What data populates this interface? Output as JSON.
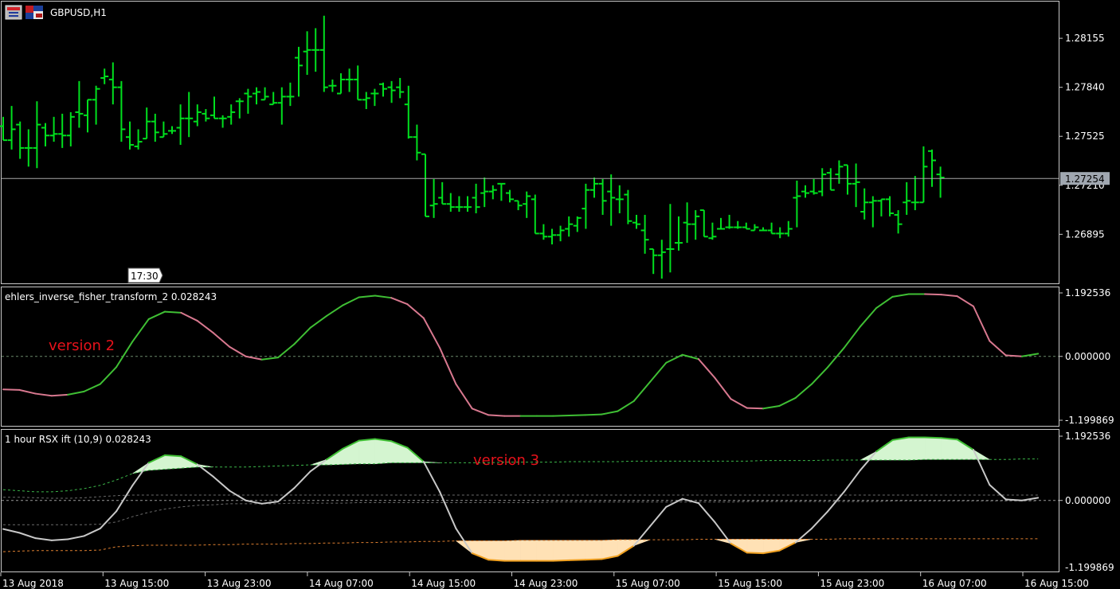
{
  "window": {
    "title": "GBPUSD,H1",
    "icons": [
      "chart-window-icon",
      "symbol-flag-icon"
    ]
  },
  "colors": {
    "background": "#000000",
    "bar": "#00e01e",
    "price_line": "#a8a8a8",
    "axis": "#c8c8c8",
    "up": "#3fbf34",
    "down": "#d8788f",
    "neutral": "#c8c8c8",
    "fill_up": "#d4f5d0",
    "fill_down": "#ffe1b5",
    "edge_down": "#f0a020",
    "level_up": "#3cb84a",
    "level_down": "#e08030",
    "annotation": "#e8121b"
  },
  "time_marker": "17:30",
  "time_axis": [
    "13 Aug 2018",
    "13 Aug 15:00",
    "13 Aug 23:00",
    "14 Aug 07:00",
    "14 Aug 15:00",
    "14 Aug 23:00",
    "15 Aug 07:00",
    "15 Aug 15:00",
    "15 Aug 23:00",
    "16 Aug 07:00",
    "16 Aug 15:00"
  ],
  "chart_data": [
    {
      "type": "ohlc",
      "symbol": "GBPUSD",
      "timeframe": "H1",
      "title": "GBPUSD,H1",
      "ylim": [
        1.266,
        1.2835
      ],
      "y_ticks": [
        "1.28155",
        "1.27840",
        "1.27525",
        "1.27210",
        "1.26895"
      ],
      "current_price": "1.27254",
      "bars": [
        [
          1.2759,
          1.2765,
          1.2756,
          1.275
        ],
        [
          1.275,
          1.2772,
          1.2744,
          1.2757
        ],
        [
          1.276,
          1.2762,
          1.2738,
          1.2745
        ],
        [
          1.2745,
          1.2757,
          1.2733,
          1.2745
        ],
        [
          1.2745,
          1.2775,
          1.2732,
          1.276
        ],
        [
          1.2758,
          1.2761,
          1.2746,
          1.2753
        ],
        [
          1.2753,
          1.2765,
          1.2749,
          1.2754
        ],
        [
          1.2754,
          1.2767,
          1.2745,
          1.2753
        ],
        [
          1.2753,
          1.2768,
          1.2746,
          1.2765
        ],
        [
          1.2768,
          1.2788,
          1.2758,
          1.2767
        ],
        [
          1.2766,
          1.2776,
          1.2755,
          1.2776
        ],
        [
          1.2776,
          1.2785,
          1.276,
          1.2783
        ],
        [
          1.279,
          1.2796,
          1.2786,
          1.2791
        ],
        [
          1.2789,
          1.28,
          1.2773,
          1.2784
        ],
        [
          1.2784,
          1.2788,
          1.2749,
          1.2757
        ],
        [
          1.2752,
          1.2762,
          1.2744,
          1.2747
        ],
        [
          1.2746,
          1.2757,
          1.2744,
          1.2749
        ],
        [
          1.2751,
          1.2771,
          1.2753,
          1.2762
        ],
        [
          1.2762,
          1.2767,
          1.2749,
          1.2755
        ],
        [
          1.2752,
          1.2762,
          1.2753,
          1.2754
        ],
        [
          1.2756,
          1.2759,
          1.2754,
          1.2756
        ],
        [
          1.2758,
          1.2773,
          1.2747,
          1.2764
        ],
        [
          1.2764,
          1.2781,
          1.2752,
          1.2764
        ],
        [
          1.2762,
          1.2773,
          1.2759,
          1.2768
        ],
        [
          1.2767,
          1.277,
          1.2762,
          1.2764
        ],
        [
          1.2766,
          1.2778,
          1.2765,
          1.2764
        ],
        [
          1.2764,
          1.2766,
          1.2758,
          1.2764
        ],
        [
          1.2765,
          1.2773,
          1.276,
          1.2768
        ],
        [
          1.2775,
          1.2777,
          1.2764,
          1.2775
        ],
        [
          1.278,
          1.2783,
          1.2767,
          1.2778
        ],
        [
          1.278,
          1.2784,
          1.2773,
          1.2781
        ],
        [
          1.2776,
          1.2784,
          1.2777,
          1.2778
        ],
        [
          1.2773,
          1.2781,
          1.2776,
          1.2774
        ],
        [
          1.2774,
          1.2784,
          1.276,
          1.2778
        ],
        [
          1.2778,
          1.2787,
          1.2772,
          1.2778
        ],
        [
          1.2803,
          1.281,
          1.2778,
          1.2798
        ],
        [
          1.2807,
          1.282,
          1.2792,
          1.2808
        ],
        [
          1.2808,
          1.2822,
          1.2794,
          1.2808
        ],
        [
          1.2808,
          1.283,
          1.2781,
          1.2784
        ],
        [
          1.2785,
          1.2789,
          1.2781,
          1.2785
        ],
        [
          1.278,
          1.2793,
          1.2781,
          1.2789
        ],
        [
          1.2789,
          1.2796,
          1.2781,
          1.2789
        ],
        [
          1.2789,
          1.2798,
          1.278,
          1.2776
        ],
        [
          1.2776,
          1.2781,
          1.277,
          1.2777
        ],
        [
          1.278,
          1.2783,
          1.2772,
          1.278
        ],
        [
          1.2786,
          1.2787,
          1.2778,
          1.2783
        ],
        [
          1.2784,
          1.2788,
          1.2774,
          1.2782
        ],
        [
          1.2784,
          1.279,
          1.2777,
          1.2781
        ],
        [
          1.2773,
          1.2785,
          1.2751,
          1.2752
        ],
        [
          1.2752,
          1.276,
          1.2737,
          1.2742
        ],
        [
          1.2741,
          1.2741,
          1.2708,
          1.2701
        ],
        [
          1.2708,
          1.2725,
          1.27,
          1.2709
        ],
        [
          1.2713,
          1.2723,
          1.271,
          1.2709
        ],
        [
          1.2709,
          1.2716,
          1.2704,
          1.2707
        ],
        [
          1.2707,
          1.2714,
          1.2704,
          1.2707
        ],
        [
          1.2707,
          1.2714,
          1.2704,
          1.2707
        ],
        [
          1.2713,
          1.2722,
          1.2703,
          1.2707
        ],
        [
          1.2716,
          1.2726,
          1.2707,
          1.2717
        ],
        [
          1.2717,
          1.2721,
          1.2712,
          1.2718
        ],
        [
          1.2722,
          1.2721,
          1.2711,
          1.2722
        ],
        [
          1.2716,
          1.2718,
          1.271,
          1.2712
        ],
        [
          1.2711,
          1.2711,
          1.2705,
          1.2708
        ],
        [
          1.2709,
          1.2717,
          1.27,
          1.2714
        ],
        [
          1.2712,
          1.2715,
          1.2691,
          1.269
        ],
        [
          1.269,
          1.2696,
          1.2686,
          1.2688
        ],
        [
          1.2688,
          1.2693,
          1.2683,
          1.2689
        ],
        [
          1.2689,
          1.2695,
          1.2685,
          1.2692
        ],
        [
          1.2693,
          1.2701,
          1.2688,
          1.2696
        ],
        [
          1.2695,
          1.2701,
          1.2691,
          1.27
        ],
        [
          1.2706,
          1.2722,
          1.2693,
          1.2718
        ],
        [
          1.2718,
          1.2726,
          1.2713,
          1.2722
        ],
        [
          1.2722,
          1.2725,
          1.2702,
          1.2711
        ],
        [
          1.2717,
          1.2728,
          1.2695,
          1.2713
        ],
        [
          1.2712,
          1.2721,
          1.2703,
          1.2712
        ],
        [
          1.2715,
          1.2718,
          1.2696,
          1.2698
        ],
        [
          1.2697,
          1.2702,
          1.2693,
          1.2696
        ],
        [
          1.2692,
          1.2702,
          1.2677,
          1.2686
        ],
        [
          1.268,
          1.2675,
          1.2664,
          1.2676
        ],
        [
          1.2676,
          1.2686,
          1.2661,
          1.2678
        ],
        [
          1.268,
          1.2709,
          1.2665,
          1.268
        ],
        [
          1.2684,
          1.2701,
          1.2679,
          1.2684
        ],
        [
          1.2697,
          1.271,
          1.2684,
          1.2696
        ],
        [
          1.2696,
          1.2705,
          1.2686,
          1.2701
        ],
        [
          1.2705,
          1.2705,
          1.2688,
          1.2688
        ],
        [
          1.2687,
          1.2697,
          1.2686,
          1.2688
        ],
        [
          1.2693,
          1.27,
          1.2693,
          1.2693
        ],
        [
          1.2694,
          1.2702,
          1.2693,
          1.2694
        ],
        [
          1.2694,
          1.2698,
          1.2693,
          1.2694
        ],
        [
          1.2694,
          1.2697,
          1.2693,
          1.2693
        ],
        [
          1.2692,
          1.2696,
          1.2695,
          1.2694
        ],
        [
          1.2692,
          1.2694,
          1.2694,
          1.2692
        ],
        [
          1.2692,
          1.2697,
          1.269,
          1.269
        ],
        [
          1.269,
          1.2694,
          1.2687,
          1.269
        ],
        [
          1.269,
          1.2698,
          1.2688,
          1.2693
        ],
        [
          1.2713,
          1.2724,
          1.2694,
          1.2714
        ],
        [
          1.2717,
          1.2721,
          1.2713,
          1.2716
        ],
        [
          1.2717,
          1.2725,
          1.2715,
          1.2716
        ],
        [
          1.2717,
          1.2732,
          1.2714,
          1.2728
        ],
        [
          1.2729,
          1.2732,
          1.2725,
          1.2718
        ],
        [
          1.2728,
          1.2737,
          1.2722,
          1.2733
        ],
        [
          1.2734,
          1.2734,
          1.2715,
          1.2722
        ],
        [
          1.2722,
          1.2735,
          1.2707,
          1.2723
        ],
        [
          1.2704,
          1.2719,
          1.2699,
          1.271
        ],
        [
          1.271,
          1.2714,
          1.2694,
          1.2711
        ],
        [
          1.2711,
          1.2712,
          1.2701,
          1.2712
        ],
        [
          1.2712,
          1.2714,
          1.2701,
          1.2703
        ],
        [
          1.2702,
          1.2705,
          1.269,
          1.2696
        ],
        [
          1.271,
          1.2723,
          1.2702,
          1.2711
        ],
        [
          1.271,
          1.2727,
          1.2705,
          1.271
        ],
        [
          1.271,
          1.2746,
          1.271,
          1.2733
        ],
        [
          1.2743,
          1.2744,
          1.272,
          1.2737
        ],
        [
          1.2728,
          1.2733,
          1.2713,
          1.2726
        ]
      ]
    },
    {
      "type": "line",
      "title": "ehlers_inverse_fisher_transform_2 0.028243",
      "annotation": "version 2",
      "ylim": [
        -1.199869,
        1.192536
      ],
      "y_ticks": [
        "1.192536",
        "0.000000",
        "-1.199869"
      ],
      "zero_line": 0,
      "values": [
        -0.62,
        -0.63,
        -0.7,
        -0.74,
        -0.72,
        -0.66,
        -0.52,
        -0.2,
        0.28,
        0.7,
        0.84,
        0.82,
        0.67,
        0.44,
        0.18,
        0.0,
        -0.06,
        -0.02,
        0.23,
        0.54,
        0.76,
        0.96,
        1.11,
        1.14,
        1.1,
        0.98,
        0.72,
        0.16,
        -0.52,
        -0.98,
        -1.1,
        -1.12,
        -1.12,
        -1.12,
        -1.12,
        -1.11,
        -1.1,
        -1.09,
        -1.03,
        -0.84,
        -0.48,
        -0.12,
        0.03,
        -0.05,
        -0.4,
        -0.8,
        -0.97,
        -0.98,
        -0.93,
        -0.78,
        -0.52,
        -0.2,
        0.16,
        0.56,
        0.91,
        1.12,
        1.17,
        1.17,
        1.16,
        1.13,
        0.94,
        0.29,
        0.02,
        0.0,
        0.05
      ],
      "direction": [
        "dn",
        "dn",
        "dn",
        "dn",
        "up",
        "up",
        "up",
        "up",
        "up",
        "up",
        "up",
        "dn",
        "dn",
        "dn",
        "dn",
        "dn",
        "up",
        "up",
        "up",
        "up",
        "up",
        "up",
        "up",
        "up",
        "dn",
        "dn",
        "dn",
        "dn",
        "dn",
        "dn",
        "dn",
        "dn",
        "up",
        "up",
        "up",
        "up",
        "up",
        "up",
        "up",
        "up",
        "up",
        "up",
        "up",
        "dn",
        "dn",
        "dn",
        "dn",
        "up",
        "up",
        "up",
        "up",
        "up",
        "up",
        "up",
        "up",
        "up",
        "up",
        "dn",
        "dn",
        "dn",
        "dn",
        "dn",
        "dn",
        "up",
        "up"
      ]
    },
    {
      "type": "area",
      "title": "1 hour RSX ift (10,9) 0.028243",
      "annotation": "version 3",
      "ylim": [
        -1.199869,
        1.192536
      ],
      "y_ticks": [
        "1.192536",
        "0.000000"
      ],
      "min_tick": "-1.199869",
      "values": [
        -0.53,
        -0.6,
        -0.7,
        -0.74,
        -0.72,
        -0.66,
        -0.52,
        -0.2,
        0.28,
        0.7,
        0.84,
        0.82,
        0.67,
        0.44,
        0.18,
        0.0,
        -0.06,
        -0.02,
        0.23,
        0.54,
        0.76,
        0.96,
        1.11,
        1.14,
        1.1,
        0.98,
        0.72,
        0.16,
        -0.52,
        -0.98,
        -1.1,
        -1.12,
        -1.12,
        -1.12,
        -1.12,
        -1.11,
        -1.1,
        -1.09,
        -1.03,
        -0.84,
        -0.48,
        -0.12,
        0.03,
        -0.05,
        -0.4,
        -0.8,
        -0.97,
        -0.98,
        -0.93,
        -0.78,
        -0.52,
        -0.2,
        0.16,
        0.56,
        0.91,
        1.12,
        1.17,
        1.17,
        1.16,
        1.13,
        0.94,
        0.29,
        0.02,
        0.0,
        0.05
      ],
      "upper_level": [
        0.2,
        0.18,
        0.16,
        0.16,
        0.18,
        0.22,
        0.28,
        0.38,
        0.5,
        0.56,
        0.58,
        0.6,
        0.62,
        0.62,
        0.62,
        0.62,
        0.63,
        0.64,
        0.65,
        0.66,
        0.66,
        0.67,
        0.68,
        0.68,
        0.7,
        0.7,
        0.7,
        0.7,
        0.7,
        0.7,
        0.7,
        0.71,
        0.71,
        0.71,
        0.71,
        0.72,
        0.72,
        0.72,
        0.72,
        0.73,
        0.73,
        0.73,
        0.73,
        0.73,
        0.73,
        0.73,
        0.73,
        0.74,
        0.74,
        0.74,
        0.74,
        0.75,
        0.75,
        0.75,
        0.75,
        0.75,
        0.75,
        0.76,
        0.76,
        0.76,
        0.76,
        0.76,
        0.76,
        0.77,
        0.77
      ],
      "lower_level": [
        -0.95,
        -0.94,
        -0.93,
        -0.93,
        -0.93,
        -0.93,
        -0.92,
        -0.86,
        -0.84,
        -0.83,
        -0.83,
        -0.83,
        -0.83,
        -0.82,
        -0.82,
        -0.81,
        -0.81,
        -0.81,
        -0.8,
        -0.8,
        -0.79,
        -0.79,
        -0.78,
        -0.78,
        -0.77,
        -0.77,
        -0.76,
        -0.76,
        -0.75,
        -0.75,
        -0.75,
        -0.75,
        -0.74,
        -0.74,
        -0.74,
        -0.74,
        -0.74,
        -0.74,
        -0.73,
        -0.73,
        -0.73,
        -0.73,
        -0.73,
        -0.72,
        -0.72,
        -0.72,
        -0.72,
        -0.72,
        -0.72,
        -0.72,
        -0.72,
        -0.72,
        -0.71,
        -0.71,
        -0.71,
        -0.71,
        -0.71,
        -0.71,
        -0.71,
        -0.71,
        -0.71,
        -0.71,
        -0.71,
        -0.71,
        -0.71
      ],
      "aux_lines": [
        {
          "name": "faint-grey",
          "values": [
            0.06,
            0.06,
            0.05,
            0.04,
            0.04,
            0.05,
            0.07,
            0.09,
            0.1,
            0.1,
            0.1,
            0.1,
            0.1,
            0.1,
            0.1,
            0.1,
            0.1,
            0.1,
            0.1,
            0.1,
            0.1,
            0.1,
            0.1,
            0.1,
            0.1,
            0.1,
            0.1,
            0.1,
            0.1,
            0.1,
            0.1,
            0.1,
            0.1,
            0.1,
            0.1,
            0.1,
            0.1,
            0.1,
            0.1,
            0.1,
            0.1,
            0.1,
            0.1,
            0.1,
            0.1,
            0.1,
            0.1,
            0.1,
            0.1,
            0.1,
            0.1,
            0.1,
            0.1,
            0.1,
            0.1,
            0.1,
            0.1,
            0.1,
            0.1,
            0.1,
            0.1,
            0.1,
            0.1,
            0.1,
            0.1
          ]
        },
        {
          "name": "grey-2",
          "values": [
            -0.45,
            -0.45,
            -0.45,
            -0.45,
            -0.45,
            -0.45,
            -0.44,
            -0.4,
            -0.3,
            -0.22,
            -0.16,
            -0.12,
            -0.09,
            -0.08,
            -0.06,
            -0.06,
            -0.06,
            -0.06,
            -0.05,
            -0.05,
            -0.05,
            -0.05,
            -0.04,
            -0.04,
            -0.04,
            -0.04,
            -0.04,
            -0.04,
            -0.04,
            -0.04,
            -0.04,
            -0.04,
            -0.04,
            -0.04,
            -0.03,
            -0.03,
            -0.03,
            -0.03,
            -0.03,
            -0.03,
            -0.03,
            -0.03,
            -0.03,
            -0.03,
            -0.03,
            -0.03,
            -0.02,
            -0.02,
            -0.02,
            -0.02,
            -0.02,
            -0.02,
            -0.02,
            -0.02,
            -0.02,
            -0.01,
            -0.01,
            -0.01,
            -0.01,
            -0.01,
            -0.01,
            -0.01,
            -0.01,
            -0.01,
            -0.01
          ]
        }
      ]
    }
  ]
}
